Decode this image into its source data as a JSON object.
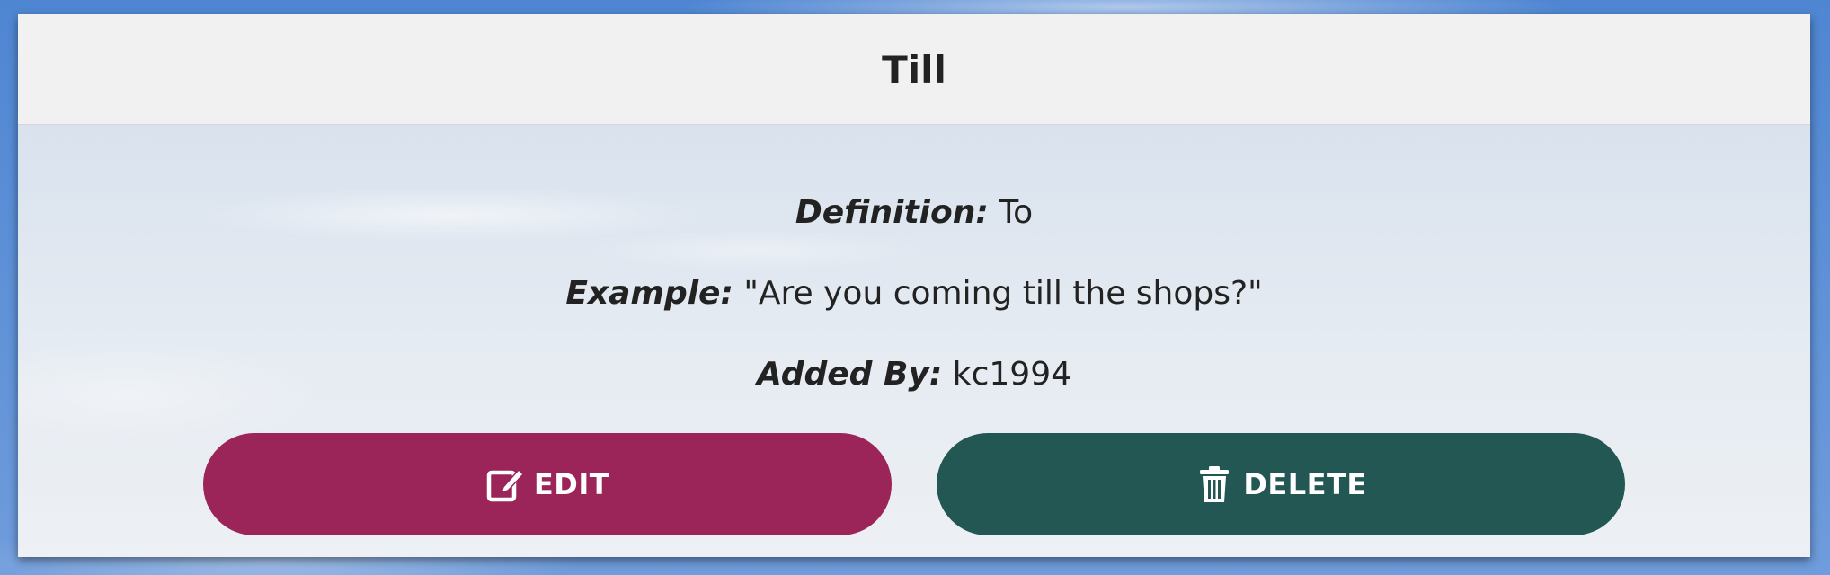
{
  "card": {
    "title": "Till",
    "definition": {
      "label": "Definition:",
      "value": "To"
    },
    "example": {
      "label": "Example:",
      "value": "\"Are you coming till the shops?\""
    },
    "added_by": {
      "label": "Added By:",
      "value": "kc1994"
    }
  },
  "actions": {
    "edit": {
      "label": "EDIT",
      "icon": "edit-icon",
      "color": "#9b2459"
    },
    "delete": {
      "label": "DELETE",
      "icon": "trash-icon",
      "color": "#235754"
    }
  }
}
